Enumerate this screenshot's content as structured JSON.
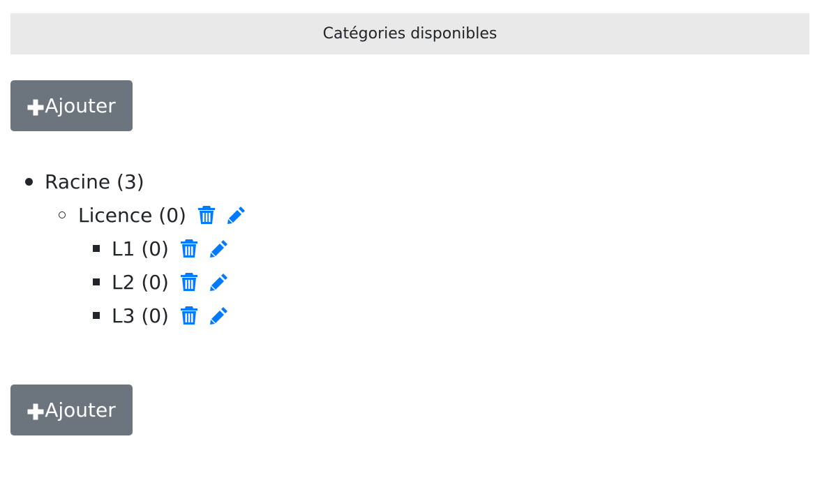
{
  "header": {
    "title": "Catégories disponibles"
  },
  "toolbar": {
    "add_label": "Ajouter"
  },
  "footer": {
    "add_label": "Ajouter"
  },
  "tree": {
    "root": {
      "label": "Racine (3)"
    },
    "child": {
      "label": "Licence (0)"
    },
    "grandchildren": [
      {
        "label": "L1 (0)"
      },
      {
        "label": "L2 (0)"
      },
      {
        "label": "L3 (0)"
      }
    ]
  },
  "colors": {
    "header_bg": "#e9e9e9",
    "button_bg": "#6c757d",
    "icon_blue": "#007bff",
    "text": "#212529"
  },
  "icons": {
    "add": "plus-icon",
    "delete": "trash-icon",
    "edit": "pencil-icon"
  }
}
